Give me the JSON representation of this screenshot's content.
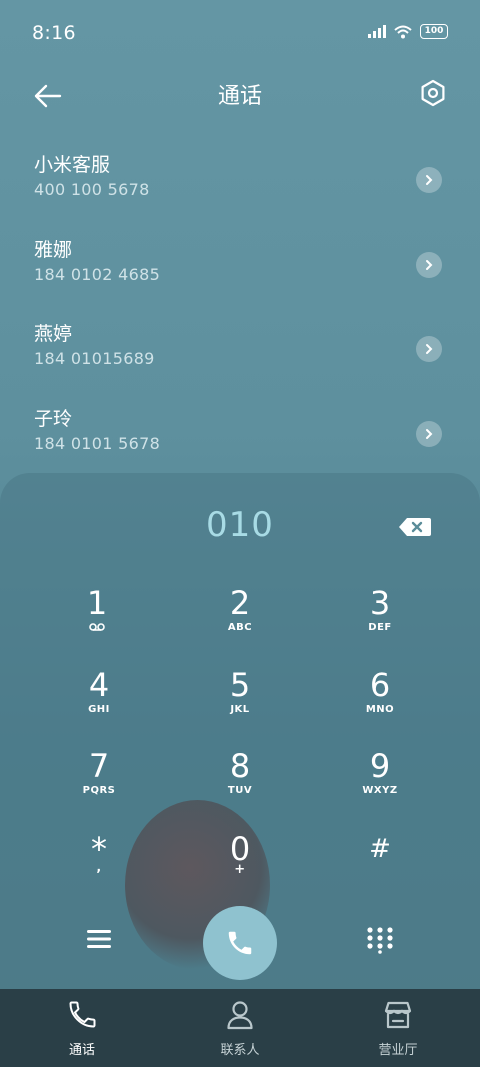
{
  "status_bar": {
    "time": "8:16",
    "battery": "100"
  },
  "header": {
    "title": "通话"
  },
  "contacts": [
    {
      "name": "小米客服",
      "number": "400 100 5678"
    },
    {
      "name": "雅娜",
      "number": "184 0102 4685"
    },
    {
      "name": "燕婷",
      "number": "184 01015689"
    },
    {
      "name": "子玲",
      "number": "184 0101 5678"
    }
  ],
  "dialpad": {
    "entered": "010",
    "keys": [
      {
        "digit": "1",
        "letters": ""
      },
      {
        "digit": "2",
        "letters": "ABC"
      },
      {
        "digit": "3",
        "letters": "DEF"
      },
      {
        "digit": "4",
        "letters": "GHI"
      },
      {
        "digit": "5",
        "letters": "JKL"
      },
      {
        "digit": "6",
        "letters": "MNO"
      },
      {
        "digit": "7",
        "letters": "PQRS"
      },
      {
        "digit": "8",
        "letters": "TUV"
      },
      {
        "digit": "9",
        "letters": "WXYZ"
      },
      {
        "digit": "*",
        "letters": ","
      },
      {
        "digit": "0",
        "letters": "+"
      },
      {
        "digit": "#",
        "letters": ""
      }
    ]
  },
  "tabs": [
    {
      "label": "通话",
      "icon": "phone-icon",
      "active": true
    },
    {
      "label": "联系人",
      "icon": "person-icon",
      "active": false
    },
    {
      "label": "营业厅",
      "icon": "store-icon",
      "active": false
    }
  ],
  "colors": {
    "accent": "#8fc2cf",
    "number_text": "#a8dbe5",
    "tabbar_bg": "#2a3f47"
  }
}
